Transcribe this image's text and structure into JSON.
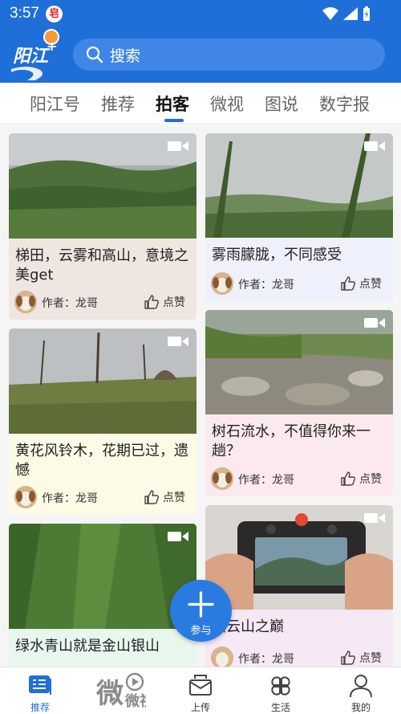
{
  "status_bar": {
    "time": "3:57",
    "notification_badge": "皂"
  },
  "header": {
    "logo_text": "阳江",
    "logo_plus": "+",
    "search_placeholder": "搜索",
    "brand_color": "#1f6fd8"
  },
  "tabs": [
    {
      "label": "阳江号",
      "active": false
    },
    {
      "label": "推荐",
      "active": false
    },
    {
      "label": "拍客",
      "active": true
    },
    {
      "label": "微视",
      "active": false
    },
    {
      "label": "图说",
      "active": false
    },
    {
      "label": "数字报",
      "active": false
    }
  ],
  "feed": {
    "cards": [
      {
        "title": "梯田，云雾和高山，意境之美get",
        "author": "作者：龙哥",
        "like": "点赞",
        "bg": "#efe6e2",
        "has_video_icon": true
      },
      {
        "title": "雾雨朦胧，不同感受",
        "author": "作者：龙哥",
        "like": "点赞",
        "bg": "#eef0fb",
        "has_video_icon": true
      },
      {
        "title": "黄花风铃木，花期已过，遗憾",
        "author": "作者：龙哥",
        "like": "点赞",
        "bg": "#fbfbe6",
        "has_video_icon": true
      },
      {
        "title": "树石流水，不值得你来一趟？",
        "author": "作者：龙哥",
        "like": "点赞",
        "bg": "#fbe9ee",
        "has_video_icon": true
      },
      {
        "title": "绿水青山就是金山银山",
        "author": "",
        "like": "",
        "bg": "#e7f7ee",
        "has_video_icon": true
      },
      {
        "title": "拍云山之巅",
        "author": "作者：龙哥",
        "like": "点赞",
        "bg": "#f7e8f6",
        "has_video_icon": true
      }
    ]
  },
  "fab": {
    "label": "参与"
  },
  "bottom_nav": [
    {
      "label": "推荐",
      "icon": "recommend-icon",
      "active": true
    },
    {
      "label": "微视",
      "icon": "weishi-logo",
      "active": false
    },
    {
      "label": "上传",
      "icon": "upload-mail-icon",
      "active": false
    },
    {
      "label": "生活",
      "icon": "life-clover-icon",
      "active": false
    },
    {
      "label": "我的",
      "icon": "profile-icon",
      "active": false
    }
  ]
}
